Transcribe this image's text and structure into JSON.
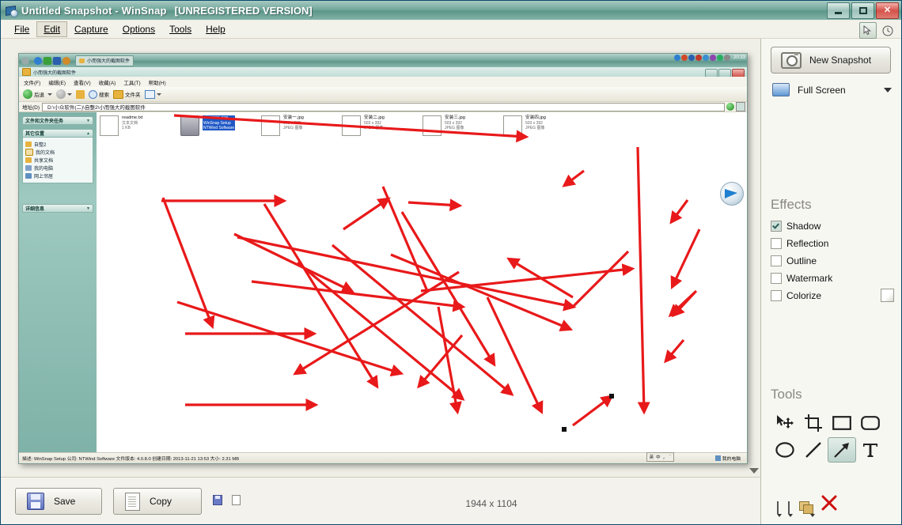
{
  "window": {
    "title": "Untitled Snapshot - WinSnap",
    "registration": "[UNREGISTERED VERSION]",
    "icon": "winsnap-icon",
    "controls": {
      "minimize": "Minimize",
      "maximize": "Maximize",
      "close": "Close"
    }
  },
  "menu": {
    "items": [
      {
        "label": "File",
        "accel": "F",
        "selected": false
      },
      {
        "label": "Edit",
        "accel": "E",
        "selected": true
      },
      {
        "label": "Capture",
        "accel": "C",
        "selected": false
      },
      {
        "label": "Options",
        "accel": "O",
        "selected": false
      },
      {
        "label": "Tools",
        "accel": "T",
        "selected": false
      },
      {
        "label": "Help",
        "accel": "H",
        "selected": false
      }
    ],
    "right_buttons": [
      {
        "name": "cursor-tool-button",
        "icon": "cursor-icon",
        "active": true
      },
      {
        "name": "timer-button",
        "icon": "clock-icon",
        "active": false
      }
    ]
  },
  "panel": {
    "new_snapshot": "New Snapshot",
    "capture_mode": "Full Screen",
    "effects_title": "Effects",
    "effects": [
      {
        "label": "Shadow",
        "checked": true
      },
      {
        "label": "Reflection",
        "checked": false
      },
      {
        "label": "Outline",
        "checked": false
      },
      {
        "label": "Watermark",
        "checked": false
      },
      {
        "label": "Colorize",
        "checked": false
      }
    ],
    "tools_title": "Tools",
    "tools": [
      {
        "name": "select-move-tool",
        "icon": "select-move-icon",
        "active": false
      },
      {
        "name": "crop-tool",
        "icon": "crop-icon",
        "active": false
      },
      {
        "name": "rectangle-tool",
        "icon": "rectangle-icon",
        "active": false
      },
      {
        "name": "rounded-rectangle-tool",
        "icon": "rounded-rectangle-icon",
        "active": false
      },
      {
        "name": "ellipse-tool",
        "icon": "ellipse-icon",
        "active": false
      },
      {
        "name": "line-tool",
        "icon": "line-icon",
        "active": false
      },
      {
        "name": "arrow-tool",
        "icon": "arrow-icon",
        "active": true
      },
      {
        "name": "text-tool",
        "icon": "text-icon",
        "active": false
      }
    ],
    "swatches": {
      "stroke_color": "#ee0000",
      "line_width_color": "#8b8b8b",
      "fill_color": "#e3c27a",
      "delete_label": "X"
    }
  },
  "bottom": {
    "save_label": "Save",
    "copy_label": "Copy",
    "dimensions": "1944 x 1104"
  },
  "screenshot": {
    "explorer": {
      "tab_title": "小而强大的截图软件",
      "bar_title": "小而强大的截图软件",
      "clock": "20:33",
      "menus": [
        "文件(F)",
        "编辑(E)",
        "查看(V)",
        "收藏(A)",
        "工具(T)",
        "帮助(H)"
      ],
      "toolbar": [
        "后退",
        "搜索",
        "文件夹"
      ],
      "address_label": "地址(D)",
      "address_path": "D:\\小众软件(二)\\自整2\\小而强大的截图软件",
      "sidebar": [
        {
          "title": "文件和文件夹任务",
          "state": "collapsed",
          "items": []
        },
        {
          "title": "其它位置",
          "state": "expanded",
          "items": [
            "自整2",
            "我的文档",
            "共享文档",
            "我的电脑",
            "网上邻居"
          ]
        },
        {
          "title": "详细信息",
          "state": "collapsed",
          "items": []
        }
      ],
      "files": [
        {
          "name": "readme.txt",
          "line2": "文本文档",
          "line3": "1 KB",
          "type": "text",
          "selected": false
        },
        {
          "name": "winsnap.exe",
          "line2": "WinSnap Setup",
          "line3": "NTWind Software",
          "type": "exe",
          "selected": true
        },
        {
          "name": "安装一.jpg",
          "line2": "503 x 392",
          "line3": "JPEG 图像",
          "type": "jpeg",
          "selected": false
        },
        {
          "name": "安装二.jpg",
          "line2": "503 x 392",
          "line3": "JPEG 图像",
          "type": "jpeg",
          "selected": false
        },
        {
          "name": "安装三.jpg",
          "line2": "503 x 392",
          "line3": "JPEG 图像",
          "type": "jpeg",
          "selected": false
        },
        {
          "name": "安装四.jpg",
          "line2": "503 x 392",
          "line3": "JPEG 图像",
          "type": "jpeg",
          "selected": false
        }
      ],
      "status": "描述: WinSnap Setup 公司: NTWind Software 文件版本: 4.0.8.0 创建日期: 2013-11-21 13:53 大小: 2.31 MB",
      "ime": [
        "英",
        "中",
        "，",
        "¨"
      ],
      "mypc": "我的电脑"
    },
    "annotation_color": "#e8191a"
  }
}
